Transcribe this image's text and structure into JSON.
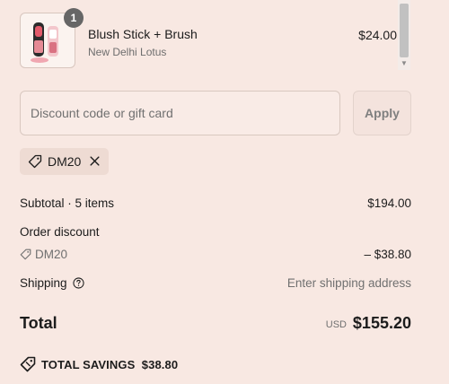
{
  "line_item": {
    "name": "Blush Stick + Brush",
    "vendor": "New Delhi Lotus",
    "price": "$24.00",
    "quantity": "1",
    "image_icon": "lipstick-product-icon"
  },
  "discount": {
    "placeholder": "Discount code or gift card",
    "value": "",
    "apply_label": "Apply"
  },
  "applied_code": {
    "code": "DM20",
    "tag_icon": "tag-icon",
    "remove_icon": "close-icon"
  },
  "summary": {
    "subtotal_label": "Subtotal · 5 items",
    "subtotal_value": "$194.00",
    "order_discount_label": "Order discount",
    "discount_code": "DM20",
    "discount_value": "– $38.80",
    "shipping_label": "Shipping",
    "shipping_value": "Enter shipping address",
    "total_label": "Total",
    "currency": "USD",
    "total_value": "$155.20",
    "savings_label": "TOTAL SAVINGS",
    "savings_value": "$38.80"
  },
  "colors": {
    "background": "#f8e8e2",
    "chip": "#eedbd3",
    "badge": "#666666"
  }
}
